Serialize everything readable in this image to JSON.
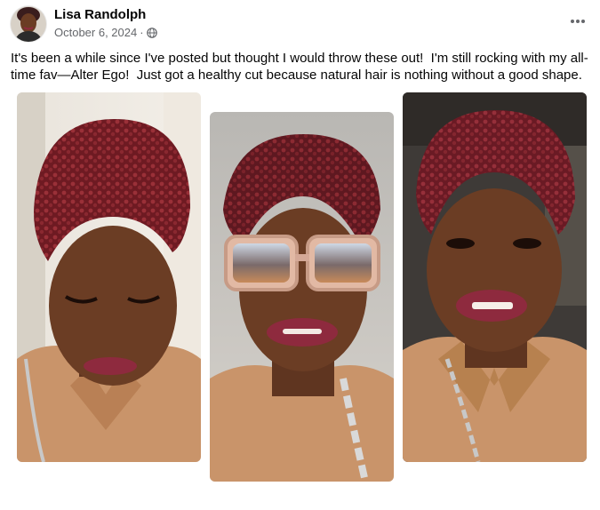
{
  "post": {
    "author": "Lisa Randolph",
    "date": "October 6, 2024",
    "separator": "·",
    "audience_icon": "globe-icon",
    "more_icon": "ellipsis-icon",
    "text": "It's been a while since I've posted but thought I would throw these out!  I'm still rocking with my all-time fav—Alter Ego!  Just got a healthy cut because natural hair is nothing without a good shape."
  },
  "photos": [
    {
      "subject": "woman looking down, curly burgundy hair, tan jacket"
    },
    {
      "subject": "woman in tortoiseshell sunglasses, burgundy curls, silver necklace"
    },
    {
      "subject": "smiling woman, burgundy curly hair, tan leather jacket"
    }
  ],
  "colors": {
    "author": "#050505",
    "secondary_text": "#65676b",
    "hair": "#7a1f26",
    "skin": "#6b3d24",
    "jacket": "#c9946a",
    "lips": "#8e2a3e"
  }
}
